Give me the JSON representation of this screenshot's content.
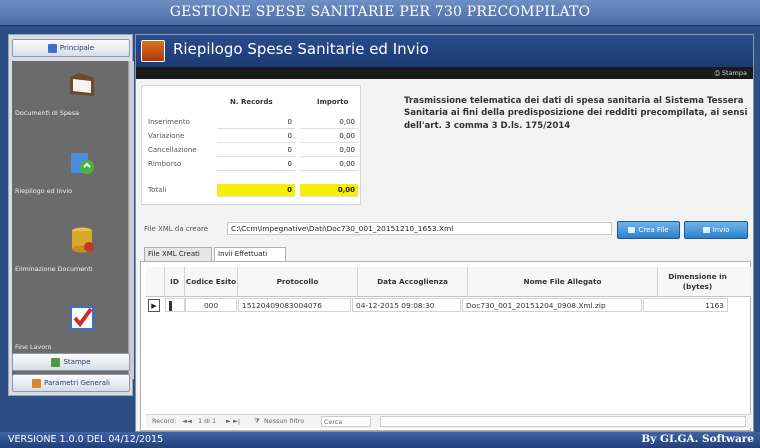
{
  "app": {
    "title": "GESTIONE SPESE SANITARIE PER 730 PRECOMPILATO"
  },
  "sidebar": {
    "top_button": "Principale",
    "items": [
      {
        "label": "Documenti di Spesa",
        "icon": "folder-icon"
      },
      {
        "label": "Riepilogo ed Invio",
        "icon": "upload-icon"
      },
      {
        "label": "Eliminazione Documenti",
        "icon": "database-icon"
      },
      {
        "label": "Fine Lavoro",
        "icon": "checkbox-exit-icon"
      }
    ],
    "bottom_buttons": [
      {
        "label": "Stampe",
        "icon": "printer-icon"
      },
      {
        "label": "Parametri Generali",
        "icon": "settings-icon"
      }
    ]
  },
  "form": {
    "title": "Riepilogo Spese Sanitarie ed Invio",
    "print_label": "Stampa"
  },
  "summary": {
    "col_records": "N. Records",
    "col_importo": "Importo",
    "rows": [
      {
        "label": "Inserimento",
        "records": "0",
        "importo": "0,00"
      },
      {
        "label": "Variazione",
        "records": "0",
        "importo": "0,00"
      },
      {
        "label": "Cancellazione",
        "records": "0",
        "importo": "0,00"
      },
      {
        "label": "Rimborso",
        "records": "0",
        "importo": "0,00"
      }
    ],
    "total": {
      "label": "Totali",
      "records": "0",
      "importo": "0,00"
    }
  },
  "description": "Trasmissione telematica dei dati di spesa sanitaria al Sistema Tessera Sanitaria ai fini della predisposizione dei redditi precompilata, ai sensi dell'art. 3 comma 3 D.ls. 175/2014",
  "xml": {
    "label": "File XML da creare",
    "path": "C:\\Ccm\\Impegnative\\Dati\\Doc730_001_20151210_1653.Xml",
    "create_button": "Crea File",
    "send_button": "Invio"
  },
  "tabs": [
    "File XML Creati",
    "Invii Effettuati"
  ],
  "grid": {
    "columns": [
      "ID",
      "Codice Esito",
      "Protocollo",
      "Data Accoglienza",
      "Nome File Allegato",
      "Dimensione in (bytes)"
    ],
    "row": {
      "id": "",
      "codice": "000",
      "protocollo": "15120409083004076",
      "data": "04-12-2015 09:08:30",
      "nome": "Doc730_001_20151204_0908.Xml.zip",
      "dimensione": "1163"
    }
  },
  "navigator": {
    "record_label": "Record:",
    "position": "1 di 1",
    "filter": "Nessun filtro",
    "search": "Cerca"
  },
  "footer": {
    "version": "VERSIONE 1.0.0 DEL 04/12/2015",
    "brand": "By GI.GA. Software"
  }
}
